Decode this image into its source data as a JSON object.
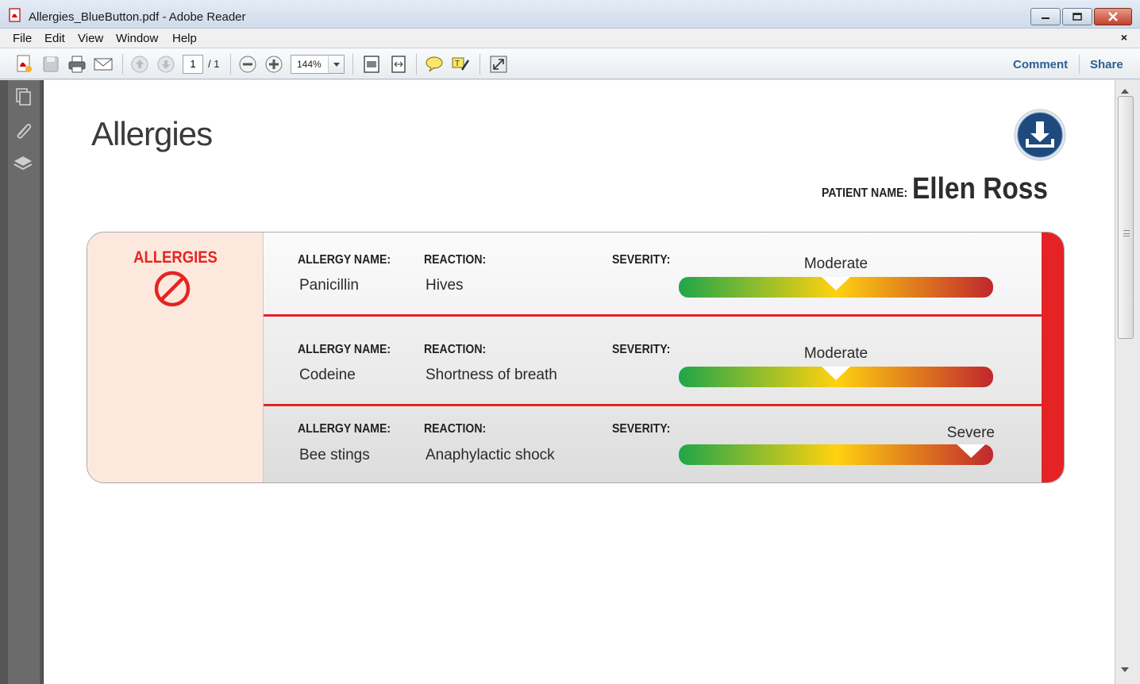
{
  "window": {
    "title": "Allergies_BlueButton.pdf - Adobe Reader"
  },
  "menu": {
    "items": [
      "File",
      "Edit",
      "View",
      "Window",
      "Help"
    ],
    "doc_close": "×"
  },
  "toolbar": {
    "page_current": "1",
    "page_total": "/ 1",
    "zoom": "144%",
    "comment_label": "Comment",
    "share_label": "Share"
  },
  "document": {
    "title": "Allergies",
    "patient_label": "PATIENT NAME:",
    "patient_name": "Ellen Ross",
    "section_label": "ALLERGIES",
    "columns": {
      "name": "ALLERGY NAME:",
      "reaction": "REACTION:",
      "severity": "SEVERITY:"
    },
    "allergies": [
      {
        "name": "Panicillin",
        "reaction": "Hives",
        "severity": "Moderate",
        "severity_level": 0.5
      },
      {
        "name": "Codeine",
        "reaction": "Shortness of breath",
        "severity": "Moderate",
        "severity_level": 0.5
      },
      {
        "name": "Bee stings",
        "reaction": "Anaphylactic shock",
        "severity": "Severe",
        "severity_level": 0.93
      }
    ]
  },
  "colors": {
    "accent_red": "#e52224",
    "severity_low": "#1fa64a",
    "severity_mid": "#ffd20f",
    "severity_high": "#c0272d",
    "download_blue": "#1e4a7d",
    "link_blue": "#2f5f93"
  },
  "icons": {
    "app": "pdf-file-icon",
    "download": "download-icon",
    "no_symbol": "prohibited-icon"
  }
}
